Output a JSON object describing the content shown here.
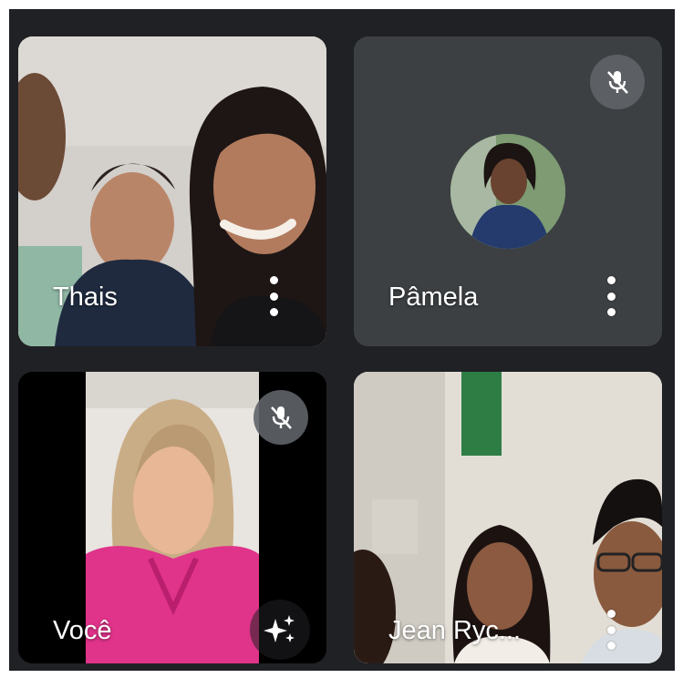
{
  "participants": [
    {
      "name": "Thais",
      "camera_on": true,
      "muted": false,
      "menu_icon": "more-vert-icon"
    },
    {
      "name": "Pâmela",
      "camera_on": false,
      "muted": true,
      "menu_icon": "more-vert-icon",
      "avatar_icon": "profile-photo"
    },
    {
      "name": "Você",
      "camera_on": true,
      "muted": true,
      "effects_icon": "sparkle-effects-icon",
      "is_self": true
    },
    {
      "name": "Jean Ryc...",
      "camera_on": true,
      "muted": false,
      "menu_icon": "more-vert-icon"
    }
  ],
  "colors": {
    "background": "#202124",
    "tile": "#3c4043",
    "mute_badge": "#5f6368",
    "text": "#ffffff"
  }
}
